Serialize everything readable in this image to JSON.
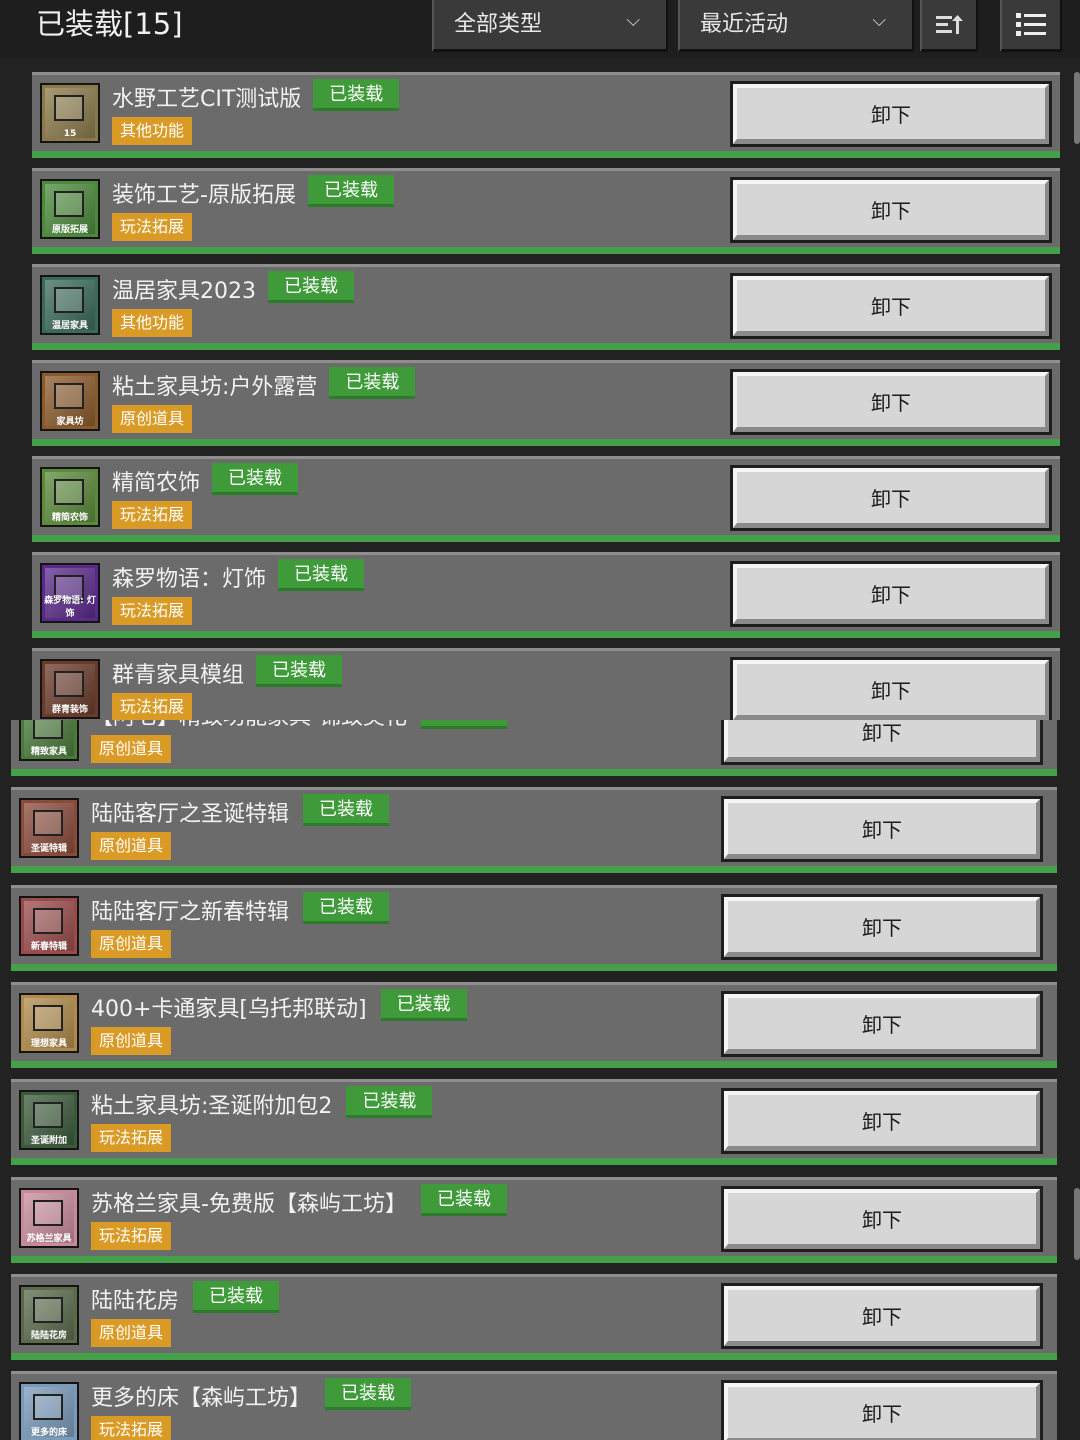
{
  "header": {
    "title": "已装载[15]",
    "filter_type": "全部类型",
    "sort_by": "最近活动"
  },
  "installed_label": "已装载",
  "unload_label": "卸下",
  "panel_a_items": [
    {
      "name": "水野工艺CIT测试版",
      "category": "其他功能",
      "thumb": "#8a7a4a",
      "caption": "15"
    },
    {
      "name": "装饰工艺-原版拓展",
      "category": "玩法拓展",
      "thumb": "#4a8a3a",
      "caption": "原版拓展"
    },
    {
      "name": "温居家具2023",
      "category": "其他功能",
      "thumb": "#3a6a5a",
      "caption": "温居家具"
    },
    {
      "name": "粘土家具坊:户外露营",
      "category": "原创道具",
      "thumb": "#8a5a2a",
      "caption": "家具坊"
    },
    {
      "name": "精简农饰",
      "category": "玩法拓展",
      "thumb": "#5a8a3a",
      "caption": "精简农饰"
    },
    {
      "name": "森罗物语：灯饰",
      "category": "玩法拓展",
      "thumb": "#5a2a8a",
      "caption": "森罗物语: 灯饰"
    },
    {
      "name": "群青家具模组",
      "category": "玩法拓展",
      "thumb": "#6a3a2a",
      "caption": "群青装饰"
    }
  ],
  "panel_b_items": [
    {
      "name": "【阿七】精致功能家具-锦致美化",
      "category": "原创道具",
      "thumb": "#4a7a3a",
      "caption": "精致家具"
    },
    {
      "name": "陆陆客厅之圣诞特辑",
      "category": "原创道具",
      "thumb": "#8a4a3a",
      "caption": "圣诞特辑"
    },
    {
      "name": "陆陆客厅之新春特辑",
      "category": "原创道具",
      "thumb": "#9a4a4a",
      "caption": "新春特辑"
    },
    {
      "name": "400+卡通家具[乌托邦联动]",
      "category": "原创道具",
      "thumb": "#b08a4a",
      "caption": "理想家具"
    },
    {
      "name": "粘土家具坊:圣诞附加包2",
      "category": "玩法拓展",
      "thumb": "#3a5a3a",
      "caption": "圣诞附加"
    },
    {
      "name": "苏格兰家具-免费版【森屿工坊】",
      "category": "玩法拓展",
      "thumb": "#c88a9a",
      "caption": "苏格兰家具"
    },
    {
      "name": "陆陆花房",
      "category": "原创道具",
      "thumb": "#5a6a4a",
      "caption": "陆陆花房"
    },
    {
      "name": "更多的床【森屿工坊】",
      "category": "玩法拓展",
      "thumb": "#7a9aba",
      "caption": "更多的床"
    }
  ]
}
